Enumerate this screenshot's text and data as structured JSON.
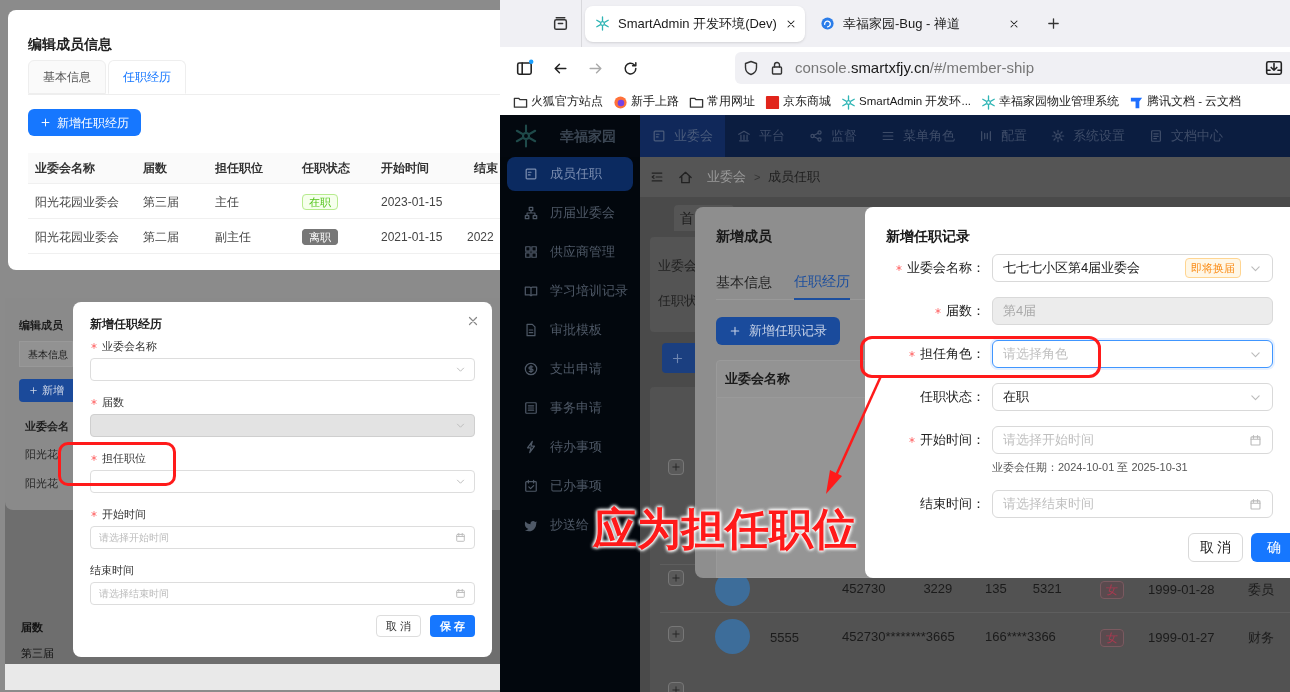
{
  "edit_member_dialog": {
    "title": "编辑成员信息",
    "tabs": [
      {
        "label": "基本信息",
        "selected": false
      },
      {
        "label": "任职经历",
        "selected": true
      }
    ],
    "add_button": "新增任职经历",
    "table": {
      "columns": [
        "业委会名称",
        "届数",
        "担任职位",
        "任职状态",
        "开始时间",
        "结束"
      ],
      "rows": [
        {
          "committee": "阳光花园业委会",
          "term": "第三届",
          "position": "主任",
          "status": "在职",
          "kind": "active",
          "start": "2023-01-15"
        },
        {
          "committee": "阳光花园业委会",
          "term": "第二届",
          "position": "副主任",
          "status": "离职",
          "kind": "left",
          "start": "2021-01-15",
          "end": "2022"
        }
      ]
    }
  },
  "history_screenshot": {
    "background": {
      "title": "编辑成员",
      "tab": "基本信息",
      "button": "新增",
      "column": "业委会名",
      "rows": [
        "阳光花",
        "阳光花"
      ],
      "lower_column": "届数",
      "lower_cell": "第三届"
    },
    "modal": {
      "title": "新增任职经历",
      "fields": [
        {
          "label": "业委会名称",
          "required": true,
          "kind": "select",
          "disabled": false,
          "highlighted": false
        },
        {
          "label": "届数",
          "required": true,
          "kind": "select",
          "disabled": true,
          "highlighted": false
        },
        {
          "label": "担任职位",
          "required": true,
          "kind": "select",
          "disabled": false,
          "highlighted": true
        },
        {
          "label": "开始时间",
          "required": true,
          "kind": "date",
          "placeholder": "请选择开始时间",
          "disabled": false,
          "highlighted": false
        },
        {
          "label": "结束时间",
          "required": false,
          "kind": "date",
          "placeholder": "请选择结束时间",
          "disabled": false,
          "highlighted": false
        }
      ],
      "buttons": [
        {
          "label": "取 消",
          "kind": "default"
        },
        {
          "label": "保 存",
          "kind": "primary"
        }
      ]
    }
  },
  "browser": {
    "tabs": [
      {
        "title": "SmartAdmin 开发环境(Dev)",
        "selected": true,
        "kind": "gear"
      },
      {
        "title": "幸福家园-Bug - 禅道",
        "selected": false,
        "kind": "swirl"
      }
    ],
    "url": {
      "subdomain": "console.",
      "domain": "smartxfjy.cn",
      "path": "/#/member-ship"
    },
    "bookmarks": [
      {
        "label": "火狐官方站点",
        "kind": "folder"
      },
      {
        "label": "新手上路",
        "kind": "firefox"
      },
      {
        "label": "常用网址",
        "kind": "folder"
      },
      {
        "label": "京东商城",
        "kind": "jd"
      },
      {
        "label": "SmartAdmin 开发环...",
        "kind": "gear"
      },
      {
        "label": "幸福家园物业管理系统",
        "kind": "gear"
      },
      {
        "label": "腾讯文档 - 云文档",
        "kind": "docs"
      }
    ]
  },
  "app": {
    "brand": "幸福家园",
    "nav": [
      {
        "label": "业委会",
        "selected": true
      },
      {
        "label": "平台",
        "selected": false
      },
      {
        "label": "监督",
        "selected": false
      },
      {
        "label": "菜单角色",
        "selected": false
      },
      {
        "label": "配置",
        "selected": false
      },
      {
        "label": "系统设置",
        "selected": false
      },
      {
        "label": "文档中心",
        "selected": false
      }
    ],
    "sidebar": [
      {
        "label": "成员任职",
        "selected": true
      },
      {
        "label": "历届业委会",
        "selected": false
      },
      {
        "label": "供应商管理",
        "selected": false
      },
      {
        "label": "学习培训记录",
        "selected": false
      },
      {
        "label": "审批模板",
        "selected": false
      },
      {
        "label": "支出申请",
        "selected": false
      },
      {
        "label": "事务申请",
        "selected": false
      },
      {
        "label": "待办事项",
        "selected": false
      },
      {
        "label": "已办事项",
        "selected": false
      },
      {
        "label": "抄送给",
        "selected": false
      }
    ],
    "breadcrumb": [
      "业委会",
      "成员任职"
    ],
    "breadcrumb_separator": ">",
    "tab_fragment": "首",
    "filter_labels": [
      "业委会",
      "任职状"
    ],
    "rows": [
      {
        "id_parts": [
          "452730",
          "3229"
        ],
        "phone_parts": [
          "135",
          "5321"
        ],
        "gender": "女",
        "birth": "1999-01-28",
        "role": "委员"
      },
      {
        "name": "5555",
        "id_parts": [
          "452730********3665"
        ],
        "phone_parts": [
          "166****3366"
        ],
        "gender": "女",
        "birth": "1999-01-27",
        "role": "财务"
      }
    ]
  },
  "member_dialog": {
    "title": "新增成员",
    "tabs": [
      {
        "label": "基本信息",
        "selected": false
      },
      {
        "label": "任职经历",
        "selected": true
      }
    ],
    "add_button": "新增任职记录",
    "column": "业委会名称"
  },
  "record_dialog": {
    "title": "新增任职记录",
    "fields": [
      {
        "label": "业委会名称：",
        "required": true,
        "kind": "select",
        "value": "七七七小区第4届业委会",
        "tag": "即将换届",
        "disabled": false,
        "focused": false,
        "highlighted": false
      },
      {
        "label": "届数：",
        "required": true,
        "kind": "input",
        "value": "第4届",
        "disabled": true,
        "focused": false,
        "highlighted": false
      },
      {
        "label": "担任角色：",
        "required": true,
        "kind": "select",
        "placeholder": "请选择角色",
        "disabled": false,
        "focused": true,
        "highlighted": true
      },
      {
        "label": "任职状态：",
        "required": false,
        "kind": "select",
        "value": "在职",
        "disabled": false,
        "focused": false,
        "highlighted": false
      },
      {
        "label": "开始时间：",
        "required": true,
        "kind": "date",
        "placeholder": "请选择开始时间",
        "hint": "业委会任期：2024-10-01 至 2025-10-31",
        "disabled": false,
        "focused": false,
        "highlighted": false
      },
      {
        "label": "结束时间：",
        "required": false,
        "kind": "date",
        "placeholder": "请选择结束时间",
        "disabled": false,
        "focused": false,
        "highlighted": false
      }
    ],
    "buttons": [
      {
        "label": "取 消",
        "kind": "default"
      },
      {
        "label": "确",
        "kind": "primary"
      }
    ]
  },
  "annotation": {
    "text": "应为担任职位"
  }
}
